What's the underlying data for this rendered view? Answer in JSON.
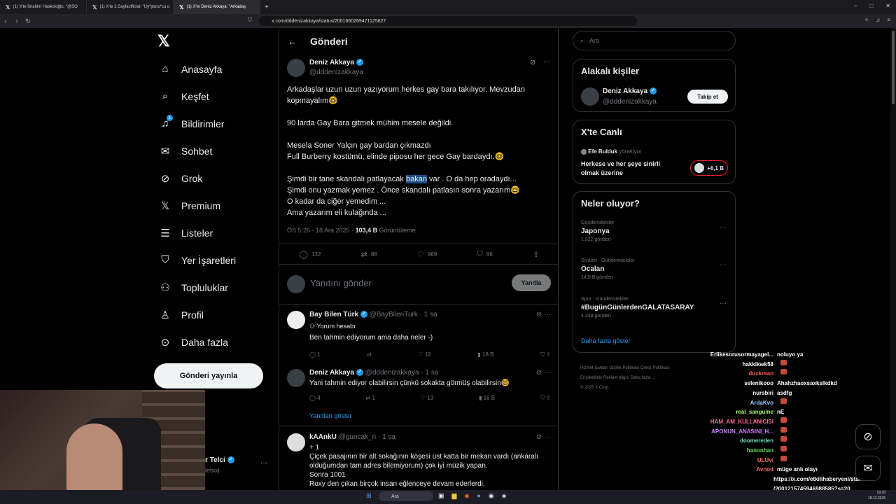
{
  "browser": {
    "tabs": [
      {
        "label": "(1) X'te İbrahim Haskoloğlu: \"@SO",
        "active": false
      },
      {
        "label": "(1) X'te 2.Sayfacfficial: \"Uy*şturu*cu o",
        "active": false
      },
      {
        "label": "(1) X'te Deniz Akkaya: \"Arkadaş",
        "active": true
      }
    ],
    "url": "x.com/dddenizakkaya/status/2001660269471125627"
  },
  "sidebar": {
    "items": [
      {
        "label": "Anasayfa",
        "icon": "home-icon"
      },
      {
        "label": "Keşfet",
        "icon": "search-icon"
      },
      {
        "label": "Bildirimler",
        "icon": "bell-icon",
        "badge": "1"
      },
      {
        "label": "Sohbet",
        "icon": "mail-icon"
      },
      {
        "label": "Grok",
        "icon": "grok-icon"
      },
      {
        "label": "Premium",
        "icon": "x-logo-icon"
      },
      {
        "label": "Listeler",
        "icon": "list-icon"
      },
      {
        "label": "Yer İşaretleri",
        "icon": "bookmark-icon"
      },
      {
        "label": "Topluluklar",
        "icon": "community-icon"
      },
      {
        "label": "Profil",
        "icon": "person-icon"
      },
      {
        "label": "Daha fazla",
        "icon": "more-circle-icon"
      }
    ],
    "post_button": "Gönderi yayınla",
    "account_name": "r Telci",
    "account_handle": "lebixi"
  },
  "header": {
    "title": "Gönderi"
  },
  "tweet": {
    "author": "Deniz Akkaya",
    "handle": "@dddenizakkaya",
    "p1": "Arkadaşlar uzun uzun yazıyorum herkes gay bara takılıyor. Mevzudan kopmayalım🤓",
    "p2": "90 larda Gay Bara  gitmek mühim mesele değildi.",
    "p3a": "Mesela Soner Yalçın gay bardan çıkmazdı",
    "p3b": "Full  Burberry kostümü, elinde piposu her gece Gay bardaydı.🤓",
    "p4a_pre": "Şimdi bir tane skandalı patlayacak ",
    "p4a_hl": "bakan",
    "p4a_post": " var . O da hep oradaydı...",
    "p4b": "Şimdi onu yazmak yemez . Önce skandalı patlasın sonra yazarım🤓",
    "p4c": "O kadar da ciğer yemedim ...",
    "p4d": "Ama yazarım eli kulağında ...",
    "time": "ÖS 5:26 · 18 Ara 2025 · ",
    "views": "103,4 B",
    "views_label": " Görüntüleme",
    "replies": "132",
    "retweets": "88",
    "likes": "969",
    "bookmarks": "96"
  },
  "reply_box": {
    "placeholder": "Yanıtını gönder",
    "button": "Yanıtla"
  },
  "replies": [
    {
      "name": "Bay Bilen Türk",
      "handle": "@BayBilenTurk · 1 sa",
      "label": "Yorum hesabı",
      "text": "Ben tahmin ediyorum ama daha neler -)",
      "r": "1",
      "rt": "",
      "l": "12",
      "v": "18 B"
    },
    {
      "name": "Deniz Akkaya",
      "handle": "@dddenizakkaya · 1 sa",
      "text": "Yani tahmin ediyor olabilirsin çünkü sokakta görmüş olabilirsin🤓",
      "r": "4",
      "rt": "1",
      "l": "13",
      "v": "16 B",
      "show_replies": "Yanıtları göster"
    },
    {
      "name": "kAAnkU",
      "handle": "@guncak_n · 1 sa",
      "l1": "+ 1",
      "l2": "Çiçek pasajının bir alt sokağının köşesi üst katta bir mekan vardı (ankaralı olduğumdan tam adres bilemiyorum) çok iyi müzik yapan.",
      "l3": "Sonra 1001",
      "l4": "Roxy den çıkan birçok insan eğlenceye devam ederlerdi."
    }
  ],
  "right": {
    "search_placeholder": "Ara",
    "related_title": "Alakalı kişiler",
    "related_name": "Deniz Akkaya",
    "related_handle": "@dddenizakkaya",
    "follow": "Takip et",
    "live_title": "X'te Canlı",
    "live_host": "Efe Bulduk",
    "live_role": "yönetiyor",
    "live_topic": "Herkese ve her şeye sinirli olmak üzerine",
    "live_count": "+6,1 B",
    "trends_title": "Neler oluyor?",
    "trends": [
      {
        "cat": "Gündemdekiler",
        "name": "Japonya",
        "count": "1.922 gönderi"
      },
      {
        "cat": "Siyaset · Gündemdekiler",
        "name": "Öcalan",
        "count": "14,9 B gönderi"
      },
      {
        "cat": "Spor · Gündemdekiler",
        "name": "#BugünGünlerdenGALATASARAY",
        "count": "4.348 gönderi"
      }
    ],
    "show_more": "Daha fazla göster",
    "footer1": "Hizmet Şartları    Gizlilik Politikası    Çerez Politikası",
    "footer2": "Erişilebilirlik    Reklam bilgisi    Daha fazla ...",
    "footer3": "© 2025 X Corp."
  },
  "chat": [
    {
      "user": "Erlikesorusormayagel...",
      "msg": "noluyo ya",
      "color": "#ffffff"
    },
    {
      "user": "hakkikwk58",
      "msg": "",
      "color": "#ffffff",
      "emote": true
    },
    {
      "user": "duckrean",
      "msg": "",
      "color": "#ff5a5a",
      "emote": true
    },
    {
      "user": "selenikooo",
      "msg": "Ahahzhaoxsaxkslkdkd",
      "color": "#ffffff"
    },
    {
      "user": "nursbiri",
      "msg": "asdfg",
      "color": "#ffffff"
    },
    {
      "user": "ArdaKvo",
      "msg": "",
      "color": "#9ad0ff",
      "emote": true
    },
    {
      "user": "real_sanguine",
      "msg": "nE",
      "color": "#a6f26a"
    },
    {
      "user": "HAM_AM_KULLANICISI",
      "msg": "",
      "color": "#ff6b9d",
      "emote": true
    },
    {
      "user": "APONUN_ANASINI_H...",
      "msg": "",
      "color": "#c77dff",
      "emote": true
    },
    {
      "user": "doomereden",
      "msg": "",
      "color": "#6ee0b5",
      "emote": true
    },
    {
      "user": "hanonhan",
      "msg": "",
      "color": "#6ee05a",
      "emote": true
    },
    {
      "user": "ULUvi",
      "msg": "",
      "color": "#ff6b6b",
      "emote": true
    },
    {
      "user": "Avnod",
      "msg": "müge anlı olayı",
      "color": "#ff6b6b"
    },
    {
      "user": "",
      "msg": "https://x.com/etkilihaberyeni/status",
      "color": "#ffffff"
    },
    {
      "user": "",
      "msg": "/2001215745946988585?s=20",
      "color": "#ffffff"
    }
  ],
  "taskbar": {
    "search": "Ara",
    "time": "19:28",
    "date": "18.12.2025"
  },
  "colors": {
    "accent": "#1d9bf0",
    "bg": "#000000",
    "border": "#2f3336",
    "muted": "#71767b"
  }
}
